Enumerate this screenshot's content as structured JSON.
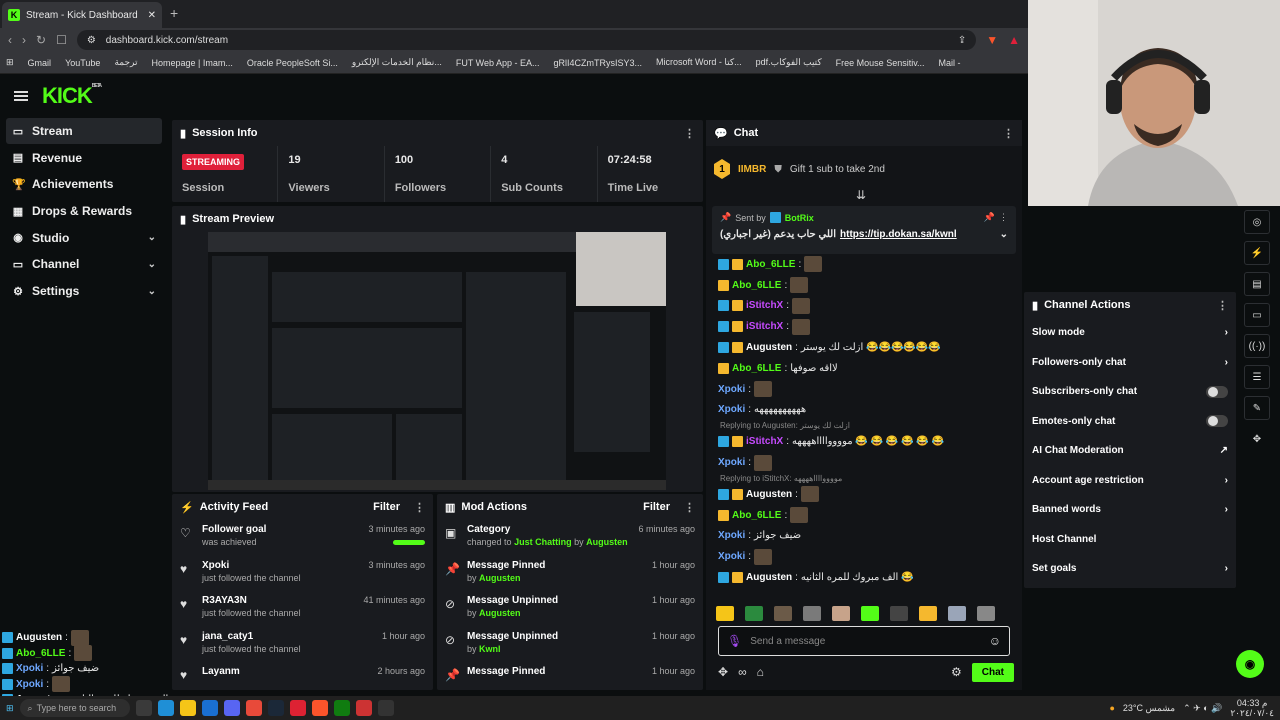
{
  "browser": {
    "tab_title": "Stream - Kick Dashboard",
    "url": "dashboard.kick.com/stream",
    "bookmarks": [
      "Gmail",
      "YouTube",
      "ترجمة",
      "Homepage | Imam...",
      "Oracle PeopleSoft Si...",
      "نظام الخدمات الإلكترو...",
      "FUT Web App - EA...",
      "gRlI4CZmTRysISY3...",
      "Microsoft Word - كتا...",
      "pdf.كتيب الفوكاب",
      "Free Mouse Sensitiv...",
      "Mail -"
    ]
  },
  "kick": {
    "logo": "KICK",
    "logo_sup": "BETA"
  },
  "sidebar": {
    "items": [
      {
        "label": "Stream",
        "icon": "stream-icon",
        "active": true
      },
      {
        "label": "Revenue",
        "icon": "revenue-icon"
      },
      {
        "label": "Achievements",
        "icon": "trophy-icon"
      },
      {
        "label": "Drops & Rewards",
        "icon": "gift-icon"
      },
      {
        "label": "Studio",
        "icon": "studio-icon",
        "expandable": true
      },
      {
        "label": "Channel",
        "icon": "channel-icon",
        "expandable": true
      },
      {
        "label": "Settings",
        "icon": "gear-icon",
        "expandable": true
      }
    ]
  },
  "session": {
    "title": "Session Info",
    "status": "STREAMING",
    "session_label": "Session",
    "viewers": "19",
    "viewers_label": "Viewers",
    "followers": "100",
    "followers_label": "Followers",
    "subs": "4",
    "subs_label": "Sub Counts",
    "time": "07:24:58",
    "time_label": "Time Live"
  },
  "preview": {
    "title": "Stream Preview"
  },
  "activity": {
    "title": "Activity Feed",
    "filter": "Filter",
    "items": [
      {
        "name": "Follower goal",
        "sub": "was achieved",
        "time": "3 minutes ago",
        "icon": "heart-outline-icon",
        "progress": 1.0
      },
      {
        "name": "Xpoki",
        "sub": "just followed the channel",
        "time": "3 minutes ago",
        "icon": "heart-icon"
      },
      {
        "name": "R3AYA3N",
        "sub": "just followed the channel",
        "time": "41 minutes ago",
        "icon": "heart-icon"
      },
      {
        "name": "jana_caty1",
        "sub": "just followed the channel",
        "time": "1 hour ago",
        "icon": "heart-icon"
      },
      {
        "name": "Layanm",
        "sub": "",
        "time": "2 hours ago",
        "icon": "heart-icon"
      }
    ]
  },
  "mod": {
    "title": "Mod Actions",
    "filter": "Filter",
    "items": [
      {
        "name": "Category",
        "pre": "changed to",
        "target": "Just Chatting",
        "by_pre": "by",
        "by": "Augusten",
        "time": "6 minutes ago",
        "icon": "category-icon"
      },
      {
        "name": "Message Pinned",
        "by_pre": "by",
        "by": "Augusten",
        "time": "1 hour ago",
        "icon": "pin-icon"
      },
      {
        "name": "Message Unpinned",
        "by_pre": "by",
        "by": "Augusten",
        "time": "1 hour ago",
        "icon": "unpin-icon"
      },
      {
        "name": "Message Unpinned",
        "by_pre": "by",
        "by": "Kwnl",
        "time": "1 hour ago",
        "icon": "unpin-icon"
      },
      {
        "name": "Message Pinned",
        "by_pre": "",
        "by": "",
        "time": "1 hour ago",
        "icon": "pin-icon"
      }
    ]
  },
  "chat": {
    "title": "Chat",
    "top_gifter": "IIMBR",
    "top_rank": "1",
    "gift_text": "Gift 1 sub to take 2nd",
    "pinned_by": "Sent by",
    "pinned_user": "BotRix",
    "pinned_text": "اللي حاب يدعم (غير اجباري)",
    "pinned_link": "https://tip.dokan.sa/kwnl",
    "messages": [
      {
        "user": "Abo_6LLE",
        "text": "",
        "color": "#53fc18",
        "badges": 2,
        "emote": true
      },
      {
        "user": "Abo_6LLE",
        "text": "",
        "color": "#53fc18",
        "badges": 1,
        "emote": true
      },
      {
        "user": "iStitchX",
        "text": "",
        "color": "#c64bff",
        "badges": 2,
        "emote": true
      },
      {
        "user": "iStitchX",
        "text": "",
        "color": "#c64bff",
        "badges": 2,
        "emote": true
      },
      {
        "user": "Augusten",
        "text": "ازلت لك يوستر 😂😂😂😂😂😂",
        "color": "#ffffff",
        "badges": 2
      },
      {
        "user": "Abo_6LLE",
        "text": "لااقه صوفها",
        "color": "#53fc18",
        "badges": 1
      },
      {
        "user": "Xpoki",
        "text": "",
        "color": "#6ea8ff",
        "badges": 0,
        "emote": true
      },
      {
        "user": "Xpoki",
        "text": "ههههههههههه",
        "color": "#6ea8ff",
        "badges": 0
      },
      {
        "reply": "Replying to Augusten: ازلت لك يوستر"
      },
      {
        "user": "iStitchX",
        "text": "مووووااااههههه 😂 😂 😂 😂 😂 😂",
        "color": "#c64bff",
        "badges": 2
      },
      {
        "user": "Xpoki",
        "text": "",
        "color": "#6ea8ff",
        "badges": 0,
        "emote": true
      },
      {
        "reply": "Replying to iStitchX: مووووااااههههه"
      },
      {
        "user": "Augusten",
        "text": "",
        "color": "#ffffff",
        "badges": 2,
        "emote": true
      },
      {
        "user": "Abo_6LLE",
        "text": "",
        "color": "#53fc18",
        "badges": 1,
        "emote": true
      },
      {
        "user": "Xpoki",
        "text": "ضيف جوائز",
        "color": "#6ea8ff",
        "badges": 0
      },
      {
        "user": "Xpoki",
        "text": "",
        "color": "#6ea8ff",
        "badges": 0,
        "emote": true
      },
      {
        "user": "Augusten",
        "text": "الف مبروك للمره الثانيه 😂",
        "color": "#ffffff",
        "badges": 2
      }
    ],
    "input_placeholder": "Send a message",
    "send_label": "Chat"
  },
  "channel_actions": {
    "title": "Channel Actions",
    "items": [
      {
        "label": "Slow mode",
        "kind": "chevron"
      },
      {
        "label": "Followers-only chat",
        "kind": "chevron"
      },
      {
        "label": "Subscribers-only chat",
        "kind": "toggle",
        "on": false
      },
      {
        "label": "Emotes-only chat",
        "kind": "toggle",
        "on": false
      },
      {
        "label": "AI Chat Moderation",
        "kind": "external"
      },
      {
        "label": "Account age restriction",
        "kind": "chevron"
      },
      {
        "label": "Banned words",
        "kind": "chevron"
      },
      {
        "label": "Host Channel",
        "kind": "none"
      },
      {
        "label": "Set goals",
        "kind": "chevron"
      }
    ]
  },
  "overlay_chat": [
    {
      "user": "Augusten",
      "color": "#ffffff"
    },
    {
      "user": "Abo_6LLE",
      "color": "#53fc18"
    },
    {
      "user": "Xpoki",
      "text": "ضيف جوائز",
      "color": "#6ea8ff"
    },
    {
      "user": "Xpoki",
      "color": "#6ea8ff"
    },
    {
      "user": "Augusten",
      "text": "الف مبروك للمره الثانيه",
      "color": "#ffffff"
    }
  ],
  "taskbar": {
    "search": "Type here to search",
    "weather": "23°C مشمس",
    "time": "04:33 م",
    "date": "٢٠٢٤/٠٧/٠٤"
  },
  "colors": {
    "accent": "#53fc18",
    "live": "#e0203a",
    "panel": "#191b1f",
    "bg": "#0b0e0f"
  }
}
